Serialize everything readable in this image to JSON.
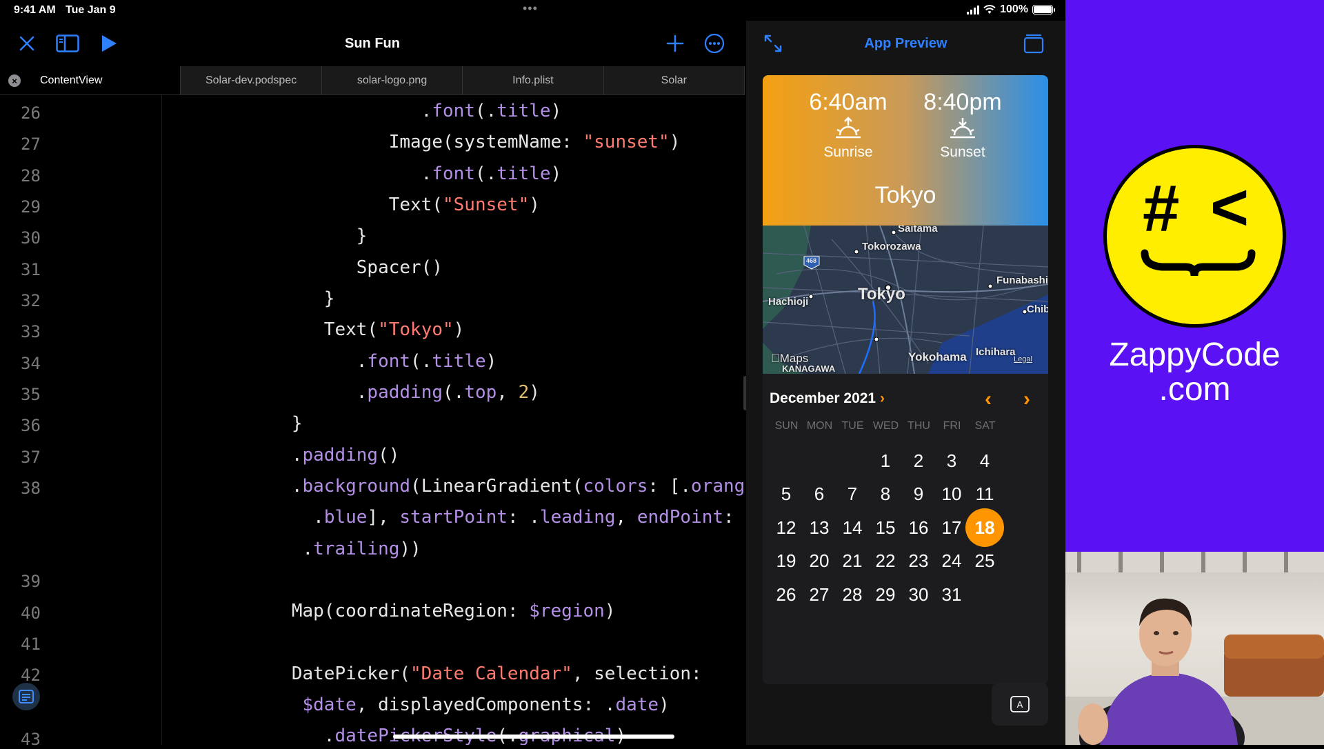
{
  "status": {
    "time": "9:41 AM",
    "date": "Tue Jan 9",
    "battery": "100%",
    "dots": "•••"
  },
  "editor": {
    "title": "Sun Fun",
    "tabs": [
      {
        "label": "ContentView",
        "active": true
      },
      {
        "label": "Solar-dev.podspec"
      },
      {
        "label": "solar-logo.png"
      },
      {
        "label": "Info.plist"
      },
      {
        "label": "Solar"
      }
    ],
    "line_numbers": [
      "26",
      "27",
      "28",
      "29",
      "30",
      "31",
      "32",
      "33",
      "34",
      "35",
      "36",
      "37",
      "38",
      "39",
      "40",
      "41",
      "42",
      "43"
    ]
  },
  "preview": {
    "title": "App Preview",
    "sunrise_time": "6:40am",
    "sunrise_label": "Sunrise",
    "sunset_time": "8:40pm",
    "sunset_label": "Sunset",
    "city": "Tokyo",
    "map": {
      "labels": [
        "Saitama",
        "Tokorozawa",
        "Hachioji",
        "Tokyo",
        "Funabashi",
        "Chiba",
        "Yokohama",
        "Ichihara",
        "KANAGAWA",
        "Legal",
        "Maps",
        "468"
      ]
    },
    "calendar": {
      "month": "December 2021",
      "month_chevron": "›",
      "prev": "‹",
      "next": "›",
      "weekdays": [
        "SUN",
        "MON",
        "TUE",
        "WED",
        "THU",
        "FRI",
        "SAT"
      ],
      "first_weekday_index": 3,
      "days_in_month": 31,
      "selected_day": 18
    }
  },
  "brand": {
    "line1": "ZappyCode",
    "line2": ".com",
    "face_text_1": "#",
    "face_text_2": "<"
  },
  "colors": {
    "accent_blue": "#2f80ff",
    "accent_orange": "#ff9500",
    "brand_purple": "#5a12f5",
    "face_yellow": "#ffee00"
  }
}
